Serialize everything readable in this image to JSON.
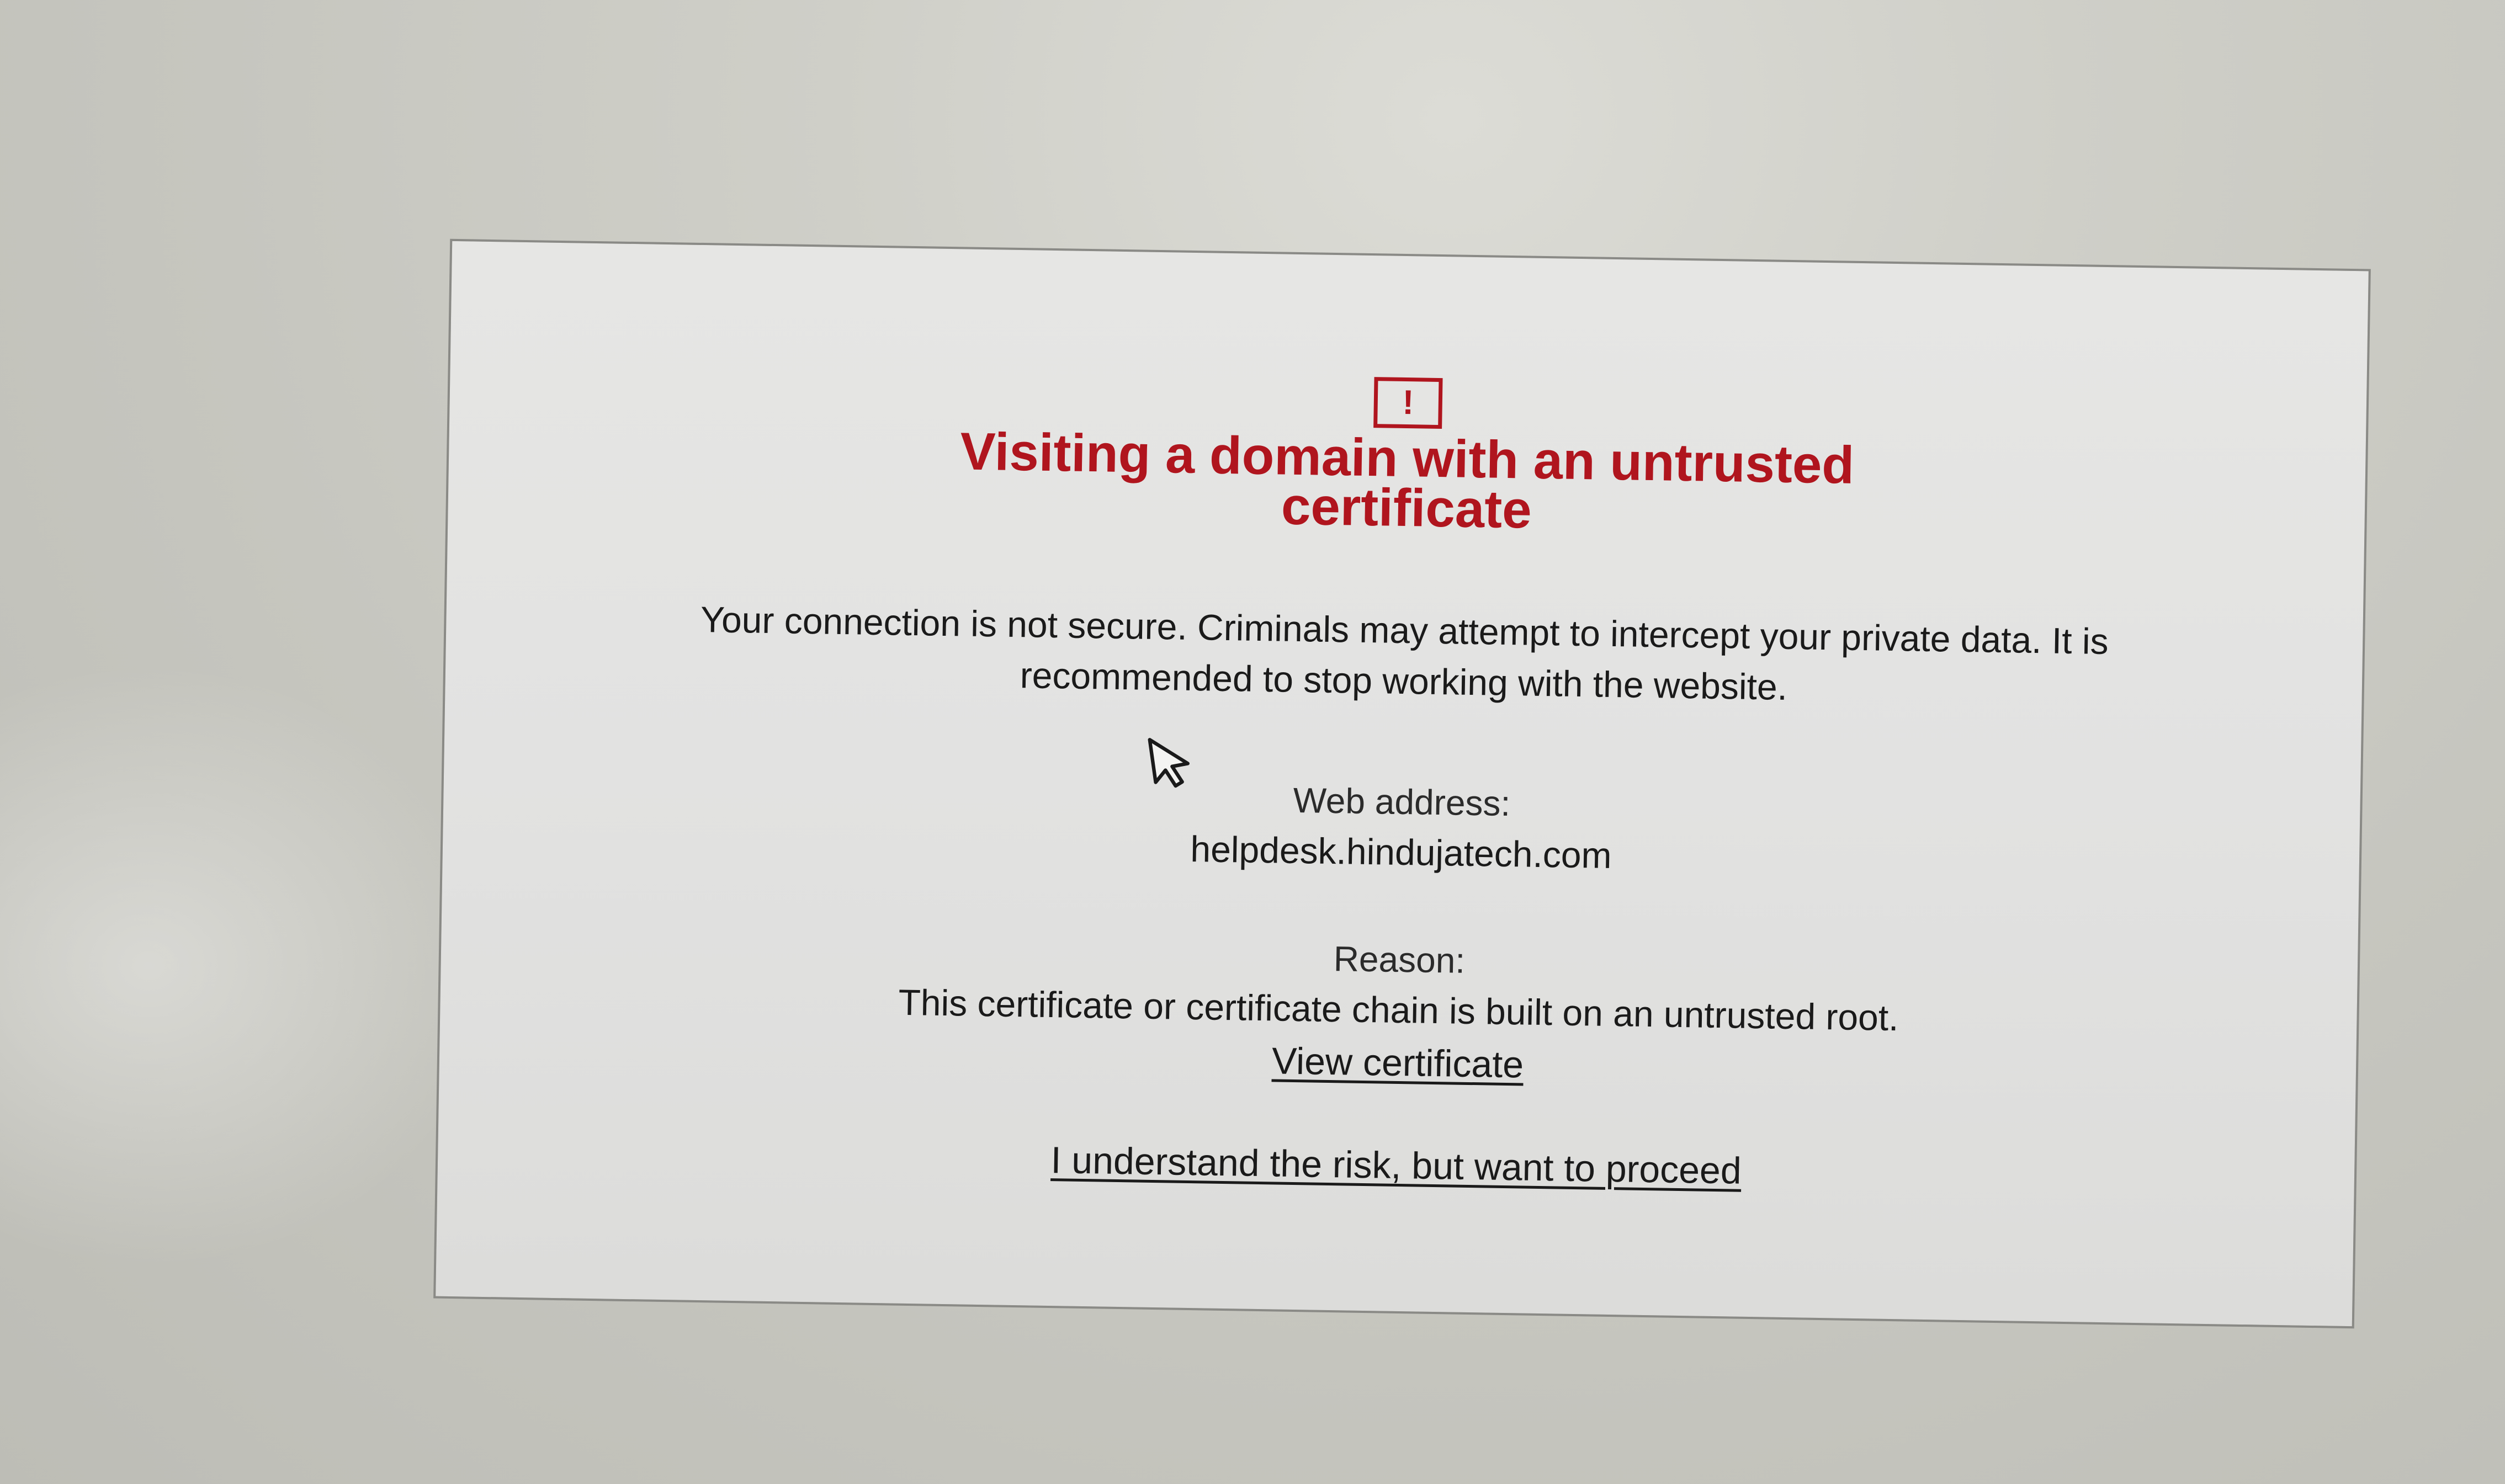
{
  "dialog": {
    "icon": "warning-exclamation-icon",
    "icon_glyph": "!",
    "title": "Visiting a domain with an untrusted certificate",
    "message": "Your connection is not secure. Criminals may attempt to intercept your private data. It is recommended to stop working with the website.",
    "web_address_label": "Web address:",
    "web_address": "helpdesk.hindujatech.com",
    "reason_label": "Reason:",
    "reason": "This certificate or certificate chain is built on an untrusted root.",
    "view_certificate_link": "View certificate",
    "proceed_link": "I understand the risk, but want to proceed"
  },
  "colors": {
    "title_red": "#b0151e",
    "text": "#1a1a1a",
    "dialog_background": "#e4e4e2"
  },
  "cursor": {
    "icon": "mouse-pointer-icon"
  }
}
